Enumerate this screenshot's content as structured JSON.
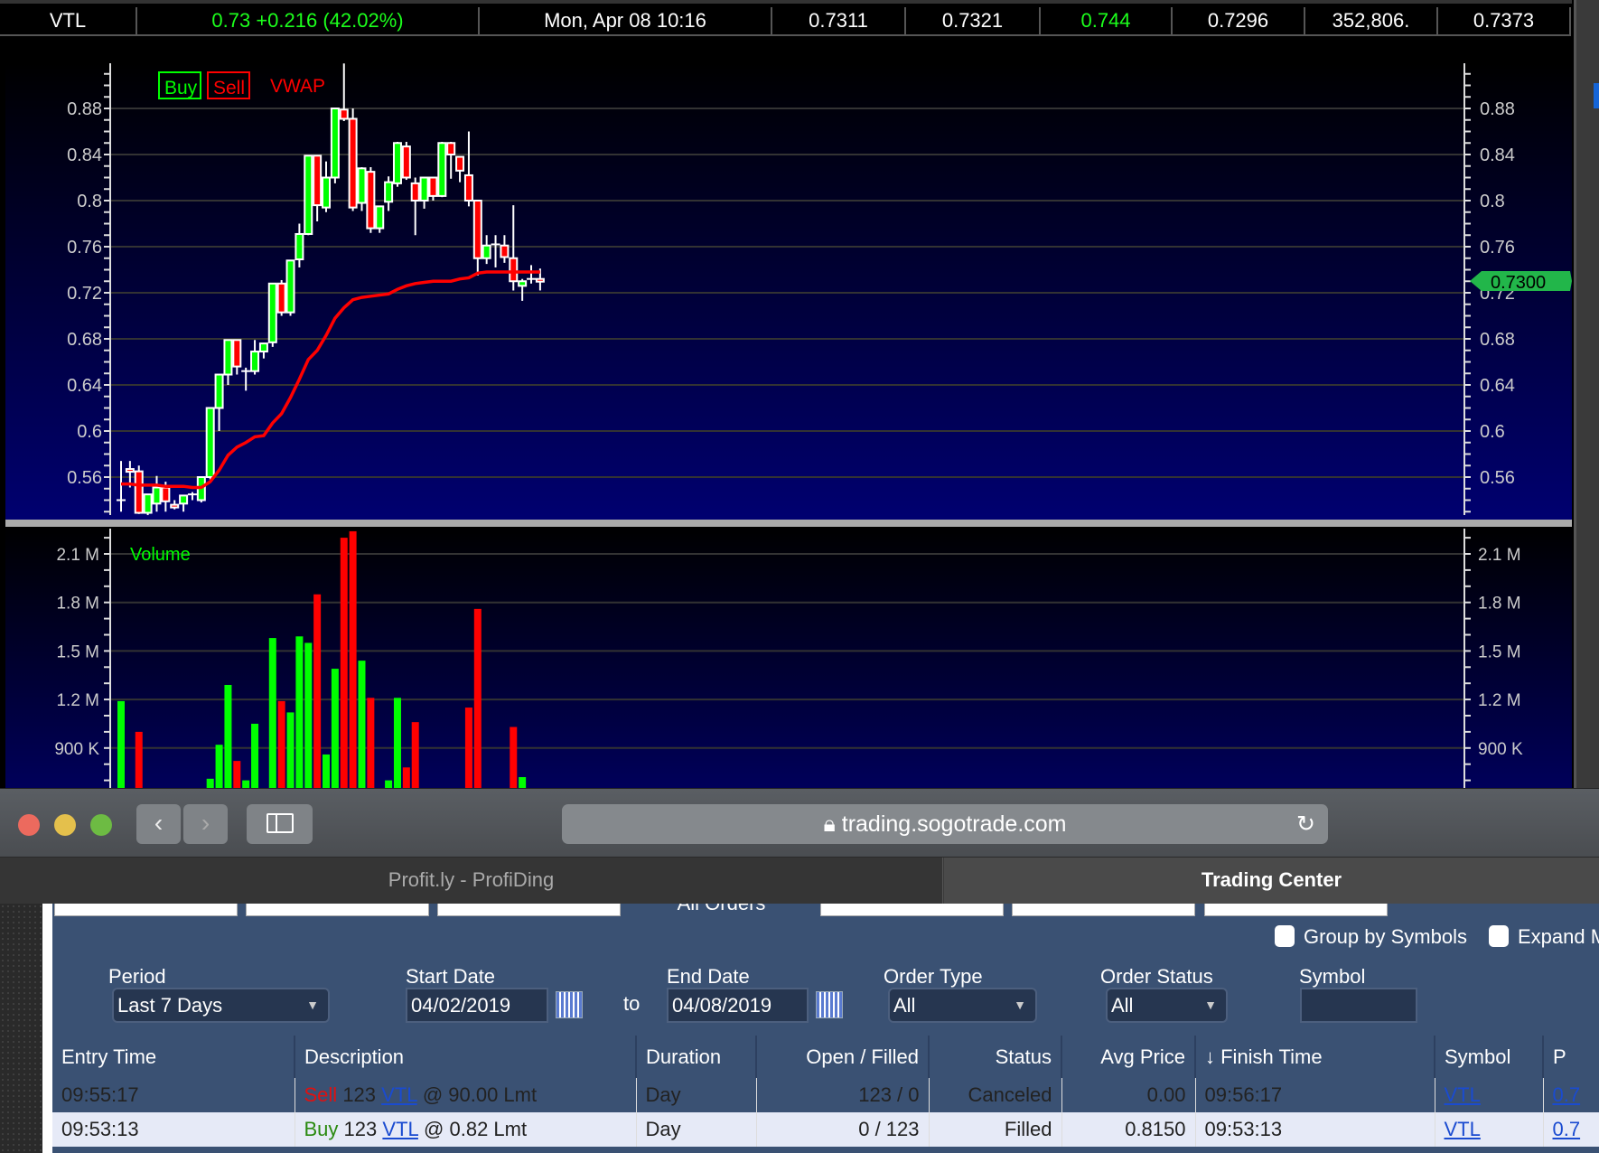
{
  "quote_bar": {
    "symbol": "VTL",
    "last": "0.73",
    "change": "+0.216 (42.02%)",
    "datetime": "Mon, Apr 08  10:16",
    "bid": "0.7311",
    "ask": "0.7321",
    "high": "0.744",
    "low": "0.7296",
    "volume": "352,806.",
    "vwap": "0.7373"
  },
  "chart_data": {
    "type": "candlestick",
    "legend": {
      "buy": "Buy",
      "sell": "Sell",
      "vwap": "VWAP"
    },
    "price_ticks": [
      "0.88",
      "0.84",
      "0.8",
      "0.76",
      "0.72",
      "0.68",
      "0.64",
      "0.6",
      "0.56"
    ],
    "price_tick_values": [
      0.88,
      0.84,
      0.8,
      0.76,
      0.72,
      0.68,
      0.64,
      0.6,
      0.56
    ],
    "price_ylim": [
      0.527,
      0.915
    ],
    "last_price_tag": "0.7300",
    "last_price": 0.73,
    "volume_label": "Volume",
    "volume_ticks": [
      "2.1 M",
      "1.8 M",
      "1.5 M",
      "1.2 M",
      "900 K"
    ],
    "volume_tick_values": [
      2.1,
      1.8,
      1.5,
      1.2,
      0.9
    ],
    "candles_ohlc": [
      [
        0.54,
        0.574,
        0.53,
        0.54
      ],
      [
        0.567,
        0.574,
        0.551,
        0.565
      ],
      [
        0.565,
        0.57,
        0.528,
        0.529
      ],
      [
        0.529,
        0.545,
        0.527,
        0.545
      ],
      [
        0.537,
        0.561,
        0.53,
        0.551
      ],
      [
        0.551,
        0.556,
        0.53,
        0.539
      ],
      [
        0.536,
        0.54,
        0.532,
        0.534
      ],
      [
        0.537,
        0.544,
        0.53,
        0.544
      ],
      [
        0.545,
        0.547,
        0.54,
        0.545
      ],
      [
        0.54,
        0.56,
        0.538,
        0.56
      ],
      [
        0.56,
        0.62,
        0.558,
        0.62
      ],
      [
        0.62,
        0.649,
        0.6,
        0.649
      ],
      [
        0.649,
        0.679,
        0.64,
        0.679
      ],
      [
        0.679,
        0.679,
        0.649,
        0.656
      ],
      [
        0.652,
        0.655,
        0.635,
        0.652
      ],
      [
        0.652,
        0.679,
        0.649,
        0.669
      ],
      [
        0.669,
        0.676,
        0.663,
        0.676
      ],
      [
        0.677,
        0.728,
        0.673,
        0.728
      ],
      [
        0.728,
        0.731,
        0.7,
        0.703
      ],
      [
        0.703,
        0.748,
        0.7,
        0.748
      ],
      [
        0.749,
        0.78,
        0.742,
        0.771
      ],
      [
        0.771,
        0.839,
        0.77,
        0.839
      ],
      [
        0.839,
        0.839,
        0.782,
        0.796
      ],
      [
        0.794,
        0.834,
        0.79,
        0.82
      ],
      [
        0.82,
        0.88,
        0.815,
        0.88
      ],
      [
        0.879,
        0.919,
        0.869,
        0.871
      ],
      [
        0.871,
        0.88,
        0.791,
        0.794
      ],
      [
        0.798,
        0.829,
        0.791,
        0.828
      ],
      [
        0.825,
        0.829,
        0.772,
        0.776
      ],
      [
        0.776,
        0.795,
        0.772,
        0.795
      ],
      [
        0.799,
        0.821,
        0.791,
        0.816
      ],
      [
        0.815,
        0.851,
        0.812,
        0.85
      ],
      [
        0.847,
        0.851,
        0.818,
        0.82
      ],
      [
        0.815,
        0.82,
        0.77,
        0.8
      ],
      [
        0.8,
        0.82,
        0.793,
        0.82
      ],
      [
        0.82,
        0.82,
        0.8,
        0.804
      ],
      [
        0.804,
        0.851,
        0.803,
        0.85
      ],
      [
        0.85,
        0.851,
        0.819,
        0.84
      ],
      [
        0.838,
        0.838,
        0.816,
        0.826
      ],
      [
        0.822,
        0.86,
        0.795,
        0.8
      ],
      [
        0.8,
        0.8,
        0.735,
        0.75
      ],
      [
        0.75,
        0.77,
        0.745,
        0.761
      ],
      [
        0.762,
        0.77,
        0.742,
        0.762
      ],
      [
        0.761,
        0.77,
        0.746,
        0.751
      ],
      [
        0.75,
        0.796,
        0.722,
        0.73
      ],
      [
        0.726,
        0.732,
        0.713,
        0.73
      ],
      [
        0.732,
        0.744,
        0.728,
        0.732
      ],
      [
        0.732,
        0.741,
        0.722,
        0.73
      ]
    ],
    "vwap": [
      0.554,
      0.554,
      0.553,
      0.553,
      0.553,
      0.552,
      0.552,
      0.552,
      0.551,
      0.551,
      0.556,
      0.566,
      0.579,
      0.586,
      0.59,
      0.595,
      0.596,
      0.607,
      0.615,
      0.629,
      0.645,
      0.662,
      0.67,
      0.683,
      0.698,
      0.707,
      0.714,
      0.716,
      0.717,
      0.718,
      0.719,
      0.723,
      0.726,
      0.728,
      0.729,
      0.73,
      0.73,
      0.73,
      0.732,
      0.733,
      0.737,
      0.738,
      0.738,
      0.738,
      0.738,
      0.738,
      0.738,
      0.738
    ],
    "volume_millions": [
      1.19,
      0.3,
      1.0,
      0.3,
      0.3,
      0.3,
      0.3,
      0.3,
      0.3,
      0.3,
      0.71,
      0.92,
      1.29,
      0.82,
      0.7,
      1.05,
      0.3,
      1.58,
      1.19,
      1.12,
      1.59,
      1.55,
      1.85,
      0.86,
      1.39,
      2.2,
      2.24,
      1.44,
      1.21,
      0.3,
      0.7,
      1.21,
      0.78,
      1.06,
      0.3,
      0.3,
      0.3,
      0.3,
      0.3,
      1.15,
      1.76,
      0.3,
      0.3,
      0.3,
      1.03,
      0.72,
      0.3,
      0.3
    ],
    "colors": {
      "up": "#00ff00",
      "down": "#ff0000",
      "vwap": "#ff0000"
    }
  },
  "browser": {
    "url": "trading.sogotrade.com",
    "tabs": [
      "Profit.ly - ProfiDing",
      "Trading Center"
    ]
  },
  "orders": {
    "subtab_active": "All Orders",
    "group_by_symbols": "Group by Symbols",
    "expand": "Expand M",
    "filters": {
      "period_label": "Period",
      "period_value": "Last 7 Days",
      "start_label": "Start Date",
      "start_value": "04/02/2019",
      "to": "to",
      "end_label": "End Date",
      "end_value": "04/08/2019",
      "type_label": "Order Type",
      "type_value": "All",
      "status_label": "Order Status",
      "status_value": "All",
      "symbol_label": "Symbol"
    },
    "columns": [
      "Entry Time",
      "Description",
      "Duration",
      "Open / Filled",
      "Status",
      "Avg Price",
      "↓ Finish Time",
      "Symbol",
      "P"
    ],
    "rows": [
      {
        "entry": "09:55:17",
        "side": "Sell",
        "qty": "123",
        "sym": "VTL",
        "rest": "@ 90.00 Lmt",
        "duration": "Day",
        "open_filled": "123 / 0",
        "status": "Canceled",
        "avg": "0.00",
        "finish": "09:56:17",
        "symbol": "VTL",
        "last": "0.7"
      },
      {
        "entry": "09:53:13",
        "side": "Buy",
        "qty": "123",
        "sym": "VTL",
        "rest": "@ 0.82 Lmt",
        "duration": "Day",
        "open_filled": "0 / 123",
        "status": "Filled",
        "avg": "0.8150",
        "finish": "09:53:13",
        "symbol": "VTL",
        "last": "0.7"
      }
    ]
  }
}
